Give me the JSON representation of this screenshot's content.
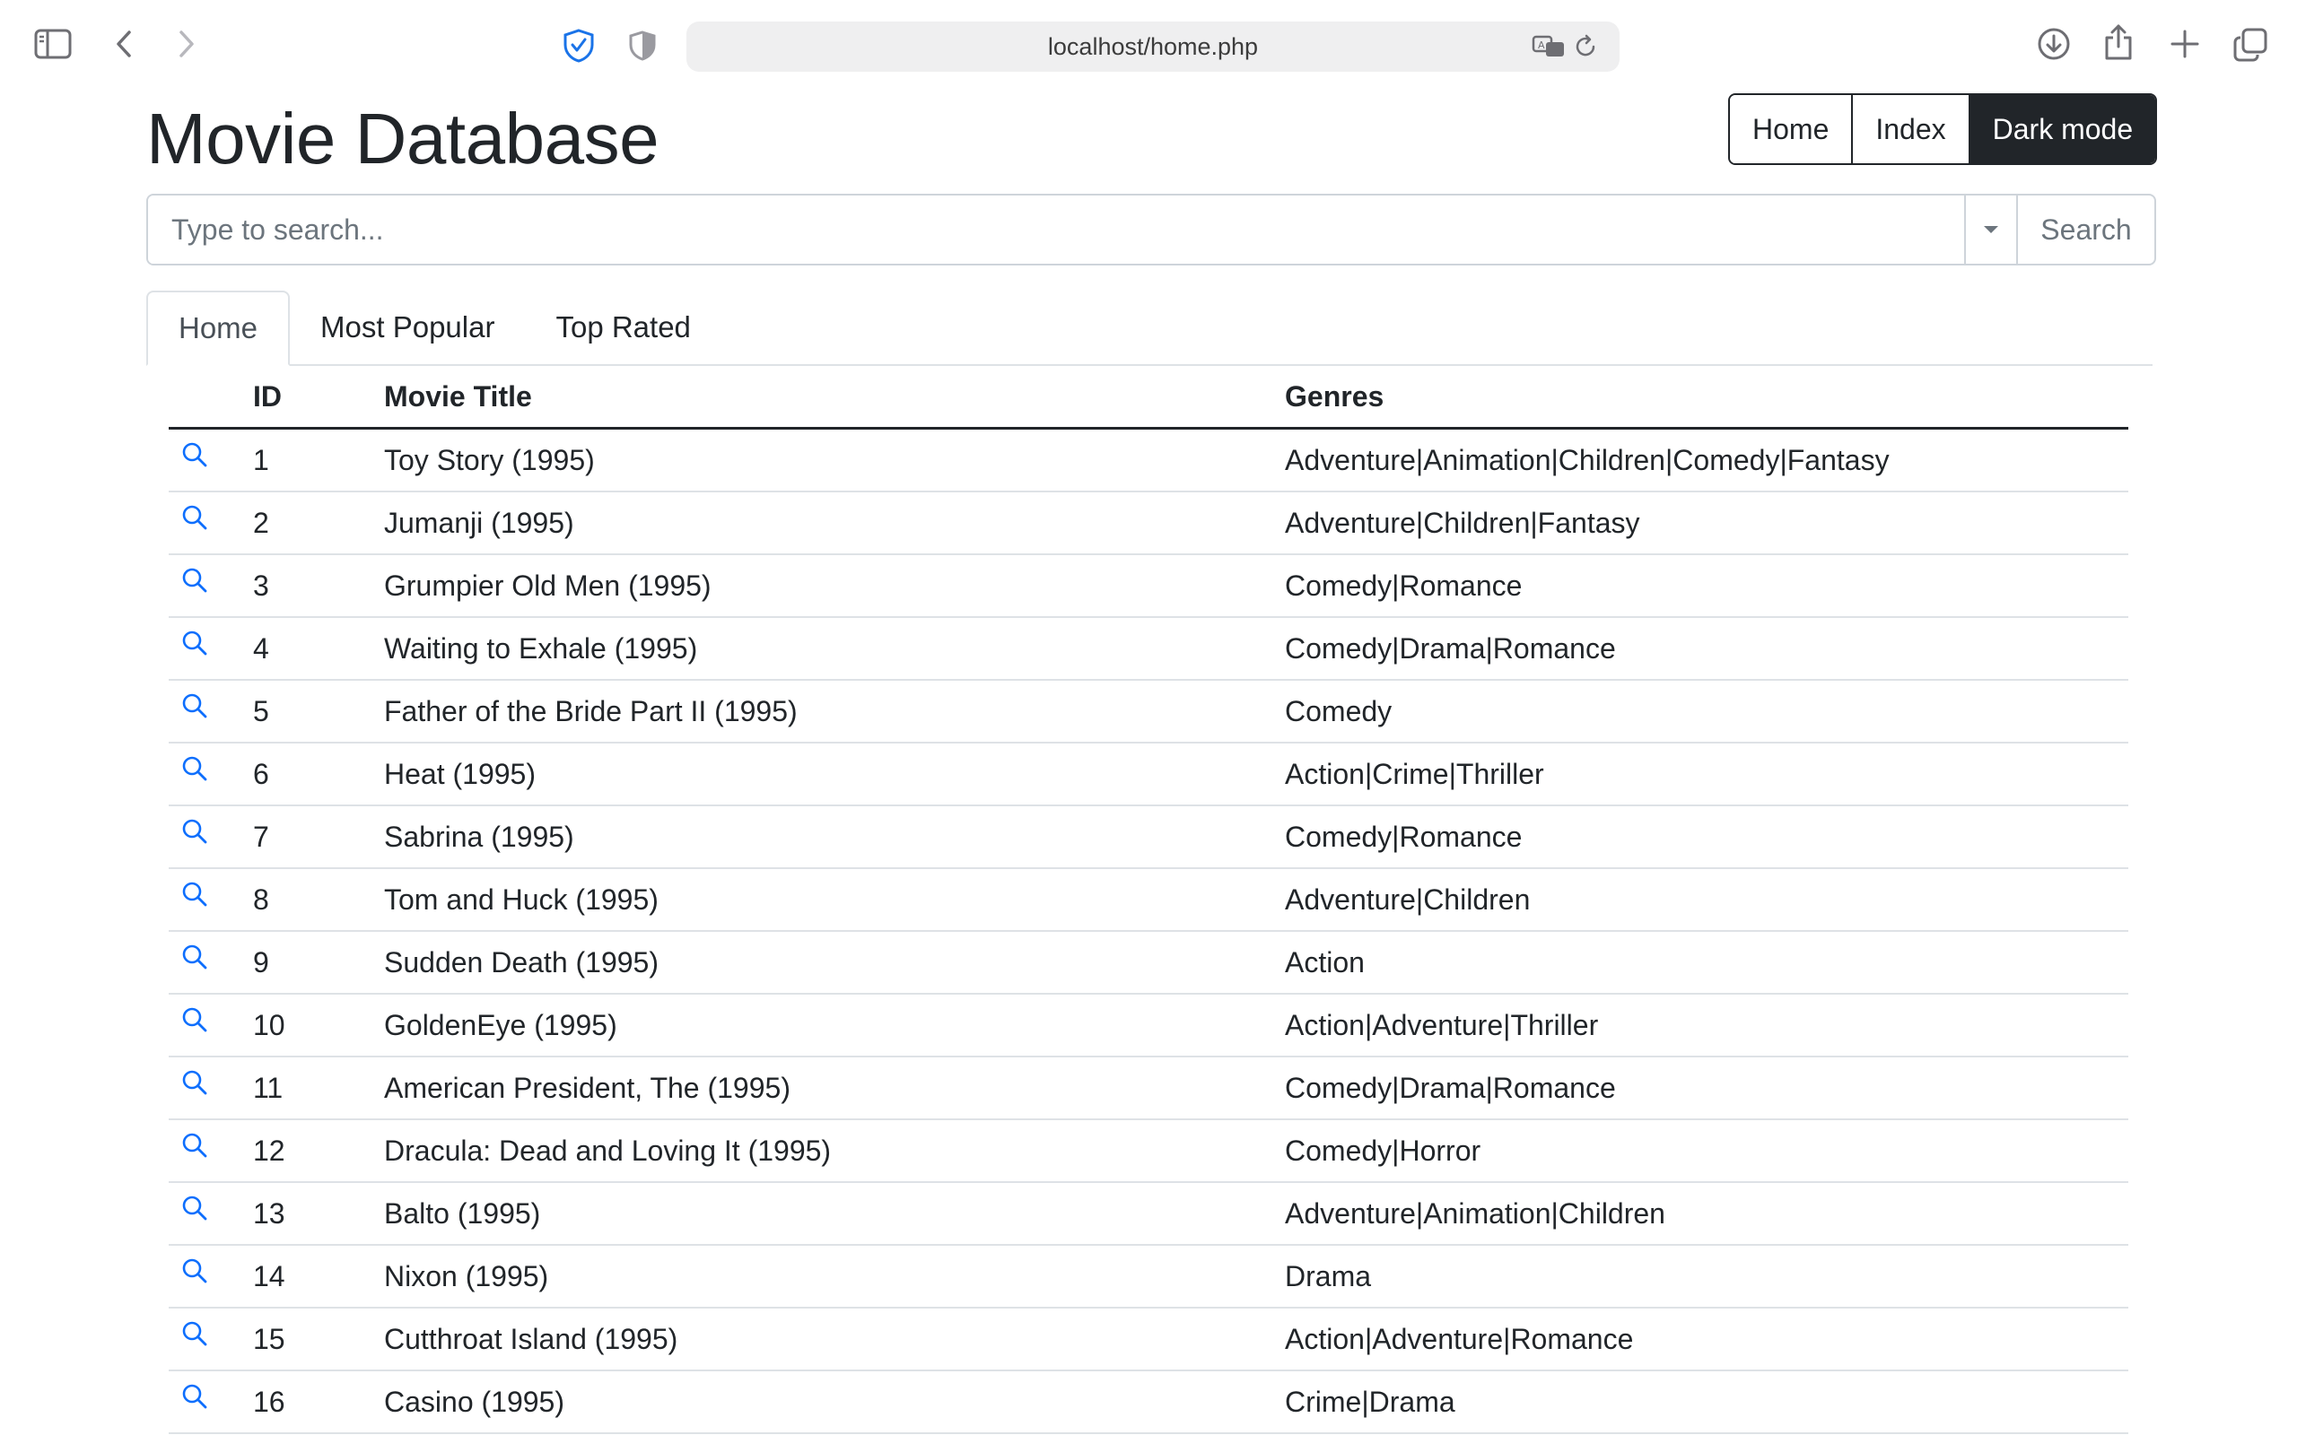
{
  "browser": {
    "url": "localhost/home.php"
  },
  "page": {
    "title": "Movie Database"
  },
  "nav_buttons": [
    {
      "label": "Home",
      "active": false
    },
    {
      "label": "Index",
      "active": false
    },
    {
      "label": "Dark mode",
      "active": true
    }
  ],
  "search": {
    "placeholder": "Type to search...",
    "button_label": "Search"
  },
  "tabs": [
    {
      "label": "Home",
      "active": true
    },
    {
      "label": "Most Popular",
      "active": false
    },
    {
      "label": "Top Rated",
      "active": false
    }
  ],
  "table": {
    "columns": [
      "",
      "ID",
      "Movie Title",
      "Genres"
    ],
    "rows": [
      {
        "id": "1",
        "title": "Toy Story (1995)",
        "genres": "Adventure|Animation|Children|Comedy|Fantasy"
      },
      {
        "id": "2",
        "title": "Jumanji (1995)",
        "genres": "Adventure|Children|Fantasy"
      },
      {
        "id": "3",
        "title": "Grumpier Old Men (1995)",
        "genres": "Comedy|Romance"
      },
      {
        "id": "4",
        "title": "Waiting to Exhale (1995)",
        "genres": "Comedy|Drama|Romance"
      },
      {
        "id": "5",
        "title": "Father of the Bride Part II (1995)",
        "genres": "Comedy"
      },
      {
        "id": "6",
        "title": "Heat (1995)",
        "genres": "Action|Crime|Thriller"
      },
      {
        "id": "7",
        "title": "Sabrina (1995)",
        "genres": "Comedy|Romance"
      },
      {
        "id": "8",
        "title": "Tom and Huck (1995)",
        "genres": "Adventure|Children"
      },
      {
        "id": "9",
        "title": "Sudden Death (1995)",
        "genres": "Action"
      },
      {
        "id": "10",
        "title": "GoldenEye (1995)",
        "genres": "Action|Adventure|Thriller"
      },
      {
        "id": "11",
        "title": "American President, The (1995)",
        "genres": "Comedy|Drama|Romance"
      },
      {
        "id": "12",
        "title": "Dracula: Dead and Loving It (1995)",
        "genres": "Comedy|Horror"
      },
      {
        "id": "13",
        "title": "Balto (1995)",
        "genres": "Adventure|Animation|Children"
      },
      {
        "id": "14",
        "title": "Nixon (1995)",
        "genres": "Drama"
      },
      {
        "id": "15",
        "title": "Cutthroat Island (1995)",
        "genres": "Action|Adventure|Romance"
      },
      {
        "id": "16",
        "title": "Casino (1995)",
        "genres": "Crime|Drama"
      }
    ]
  },
  "colors": {
    "link_blue": "#0d6efd",
    "dark": "#212529",
    "border": "#dee2e6"
  }
}
